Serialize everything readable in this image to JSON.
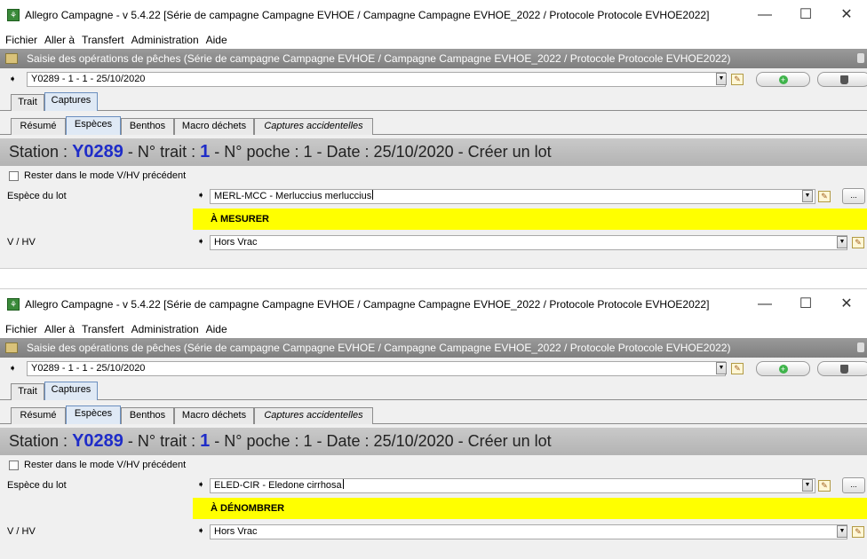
{
  "windows": [
    {
      "title": "Allegro Campagne - v 5.4.22 [Série de campagne Campagne EVHOE / Campagne Campagne EVHOE_2022 / Protocole Protocole EVHOE2022]",
      "menu": [
        "Fichier",
        "Aller à",
        "Transfert",
        "Administration",
        "Aide"
      ],
      "frame_title": "Saisie des opérations de pêches (Série de campagne Campagne EVHOE / Campagne Campagne EVHOE_2022 / Protocole Protocole EVHOE2022)",
      "station_value": "Y0289 - 1 - 1 - 25/10/2020",
      "main_tabs": [
        "Trait",
        "Captures"
      ],
      "sub_tabs": [
        "Résumé",
        "Espèces",
        "Benthos",
        "Macro déchets",
        "Captures accidentelles"
      ],
      "header": {
        "station_label": "Station :",
        "station_code": "Y0289",
        "trait_label": "- N° trait :",
        "trait_num": "1",
        "rest": "- N° poche : 1 - Date : 25/10/2020 - Créer un lot"
      },
      "checkbox_label": "Rester dans le mode V/HV précédent",
      "species_label": "Espèce du lot",
      "species_value": "MERL-MCC - Merluccius merluccius",
      "status_banner": "À MESURER",
      "vhv_label": "V / HV",
      "vhv_value": "Hors Vrac"
    },
    {
      "title": "Allegro Campagne - v 5.4.22 [Série de campagne Campagne EVHOE / Campagne Campagne EVHOE_2022 / Protocole Protocole EVHOE2022]",
      "menu": [
        "Fichier",
        "Aller à",
        "Transfert",
        "Administration",
        "Aide"
      ],
      "frame_title": "Saisie des opérations de pêches (Série de campagne Campagne EVHOE / Campagne Campagne EVHOE_2022 / Protocole Protocole EVHOE2022)",
      "station_value": "Y0289 - 1 - 1 - 25/10/2020",
      "main_tabs": [
        "Trait",
        "Captures"
      ],
      "sub_tabs": [
        "Résumé",
        "Espèces",
        "Benthos",
        "Macro déchets",
        "Captures accidentelles"
      ],
      "header": {
        "station_label": "Station :",
        "station_code": "Y0289",
        "trait_label": "- N° trait :",
        "trait_num": "1",
        "rest": "- N° poche : 1 - Date : 25/10/2020 - Créer un lot"
      },
      "checkbox_label": "Rester dans le mode V/HV précédent",
      "species_label": "Espèce du lot",
      "species_value": "ELED-CIR - Eledone cirrhosa",
      "status_banner": "À DÉNOMBRER",
      "vhv_label": "V / HV",
      "vhv_value": "Hors Vrac"
    }
  ],
  "window_controls": {
    "minimize": "—",
    "maximize": "☐",
    "close": "✕"
  },
  "browse_button": "..."
}
